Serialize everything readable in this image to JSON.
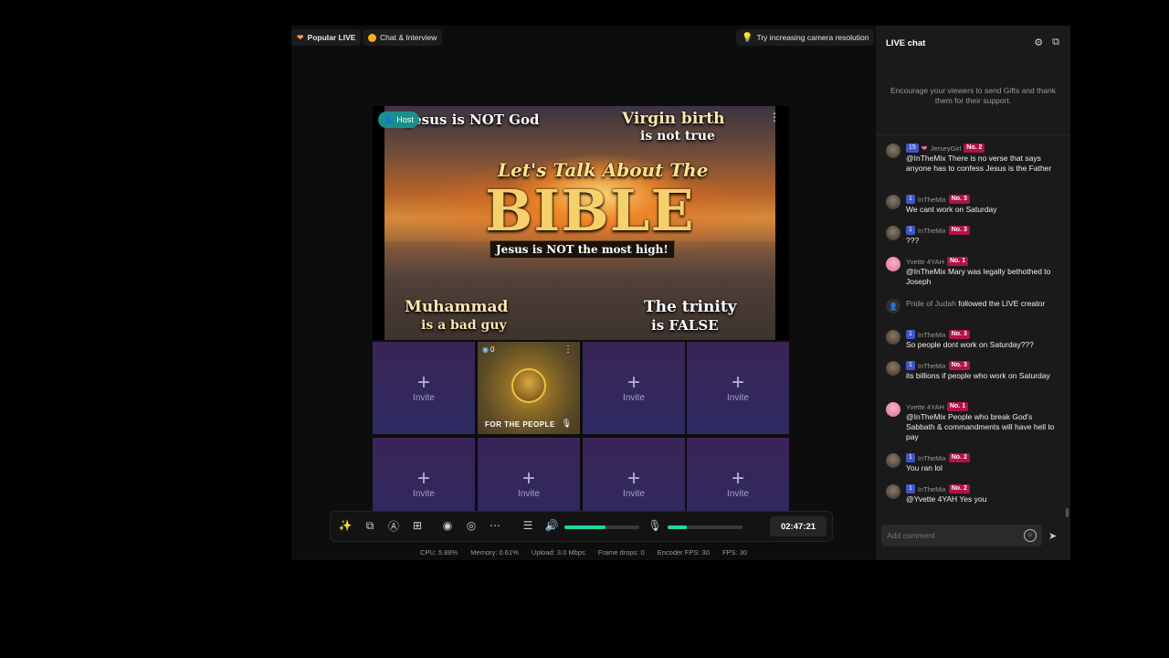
{
  "topbar": {
    "popular_live": "Popular LIVE",
    "chat_interview": "Chat & Interview",
    "tip": "Try increasing camera resolution"
  },
  "host": {
    "badge": "Host",
    "thumbnail": {
      "top_left": "Jesus is NOT God",
      "top_right_1": "Virgin birth",
      "top_right_2": "is not true",
      "script": "Let's Talk About The",
      "big": "BIBLE",
      "banner": "Jesus is NOT the most high!",
      "bottom_left_1": "Muhammad",
      "bottom_left_2": "is a bad guy",
      "bottom_right_1": "The trinity",
      "bottom_right_2": "is FALSE"
    }
  },
  "guest": {
    "count": "0",
    "name": "FOR THE PEOPLE"
  },
  "invite_label": "Invite",
  "toolbar": {
    "volume_level": 0.55,
    "mic_level": 0.25,
    "timer": "02:47:21"
  },
  "stats": {
    "cpu": "CPU:  5.88%",
    "memory": "Memory:  0.61%",
    "upload": "Upload:  3.0 Mbps",
    "frame_drops": "Frame drops:  0",
    "encoder_fps": "Encoder FPS:  30",
    "fps": "FPS:  30"
  },
  "chat": {
    "title": "LIVE chat",
    "encourage": "Encourage your viewers to send Gifts and thank them for their support.",
    "placeholder": "Add comment",
    "messages": [
      {
        "level": "15",
        "user": "JerseyGirl",
        "rank": "No. 2",
        "text": "@InTheMix There is no verse that says anyone has to confess Jesus is the Father"
      },
      {
        "level": "1",
        "user": "InTheMix",
        "rank": "No. 3",
        "text": "We cant work on Saturday"
      },
      {
        "level": "1",
        "user": "InTheMix",
        "rank": "No. 3",
        "text": "???"
      },
      {
        "user": "Yvette 4YAH",
        "rank": "No. 1",
        "text": "@InTheMix Mary was legally bethothed to Joseph"
      },
      {
        "user": "Pride of Judah",
        "text": "followed the LIVE creator"
      },
      {
        "level": "1",
        "user": "InTheMix",
        "rank": "No. 3",
        "text": "So people dont work on Saturday???"
      },
      {
        "level": "1",
        "user": "InTheMix",
        "rank": "No. 3",
        "text": "its billions if people who work on Saturday"
      },
      {
        "user": "Yvette 4YAH",
        "rank": "No. 1",
        "text": "@InTheMix People who break God's Sabbath & commandments will have hell to pay"
      },
      {
        "level": "1",
        "user": "InTheMix",
        "rank": "No. 2",
        "text": "You ran lol"
      },
      {
        "level": "1",
        "user": "InTheMix",
        "rank": "No. 2",
        "text": "@Yvette 4YAH Yes you"
      }
    ]
  },
  "colors": {
    "accent": "#20d6a8",
    "rank_badge": "#b0124a",
    "level_badge": "#3d56c8",
    "host_badge": "#1c8f8a"
  }
}
